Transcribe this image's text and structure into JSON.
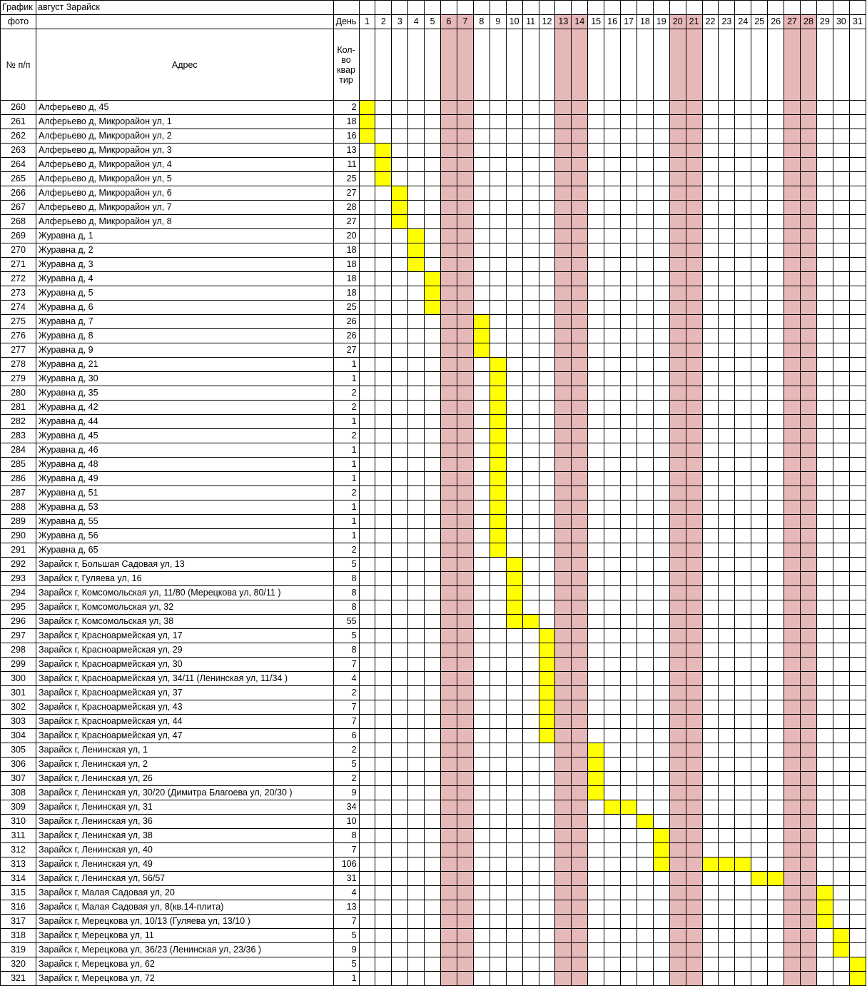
{
  "header": {
    "row1_col1": "График",
    "row1_col2": "август Зарайск",
    "row2_col1": "фото",
    "row2_col3": "День",
    "row3_col1": "№ п/п",
    "row3_col2": "Адрес",
    "row3_col3_lines": [
      "Кол-",
      "во",
      "квар",
      "тир"
    ]
  },
  "days": [
    "1",
    "2",
    "3",
    "4",
    "5",
    "6",
    "7",
    "8",
    "9",
    "10",
    "11",
    "12",
    "13",
    "14",
    "15",
    "16",
    "17",
    "18",
    "19",
    "20",
    "21",
    "22",
    "23",
    "24",
    "25",
    "26",
    "27",
    "28",
    "29",
    "30",
    "31"
  ],
  "weekend_days": [
    6,
    7,
    13,
    14,
    20,
    21,
    27,
    28
  ],
  "colors": {
    "weekend": "#e6b8b7",
    "scheduled": "#ffff00"
  },
  "rows": [
    {
      "n": "260",
      "addr": "Алферьево д, 45",
      "cnt": "2",
      "days": [
        1
      ]
    },
    {
      "n": "261",
      "addr": "Алферьево д, Микрорайон ул, 1",
      "cnt": "18",
      "days": [
        1
      ]
    },
    {
      "n": "262",
      "addr": "Алферьево д, Микрорайон ул, 2",
      "cnt": "16",
      "days": [
        1
      ]
    },
    {
      "n": "263",
      "addr": "Алферьево д, Микрорайон ул, 3",
      "cnt": "13",
      "days": [
        2
      ]
    },
    {
      "n": "264",
      "addr": "Алферьево д, Микрорайон ул, 4",
      "cnt": "11",
      "days": [
        2
      ]
    },
    {
      "n": "265",
      "addr": "Алферьево д, Микрорайон ул, 5",
      "cnt": "25",
      "days": [
        2
      ]
    },
    {
      "n": "266",
      "addr": "Алферьево д, Микрорайон ул, 6",
      "cnt": "27",
      "days": [
        3
      ]
    },
    {
      "n": "267",
      "addr": "Алферьево д, Микрорайон ул, 7",
      "cnt": "28",
      "days": [
        3
      ]
    },
    {
      "n": "268",
      "addr": "Алферьево д, Микрорайон ул, 8",
      "cnt": "27",
      "days": [
        3
      ]
    },
    {
      "n": "269",
      "addr": "Журавна д, 1",
      "cnt": "20",
      "days": [
        4
      ]
    },
    {
      "n": "270",
      "addr": "Журавна д, 2",
      "cnt": "18",
      "days": [
        4
      ]
    },
    {
      "n": "271",
      "addr": "Журавна д, 3",
      "cnt": "18",
      "days": [
        4
      ]
    },
    {
      "n": "272",
      "addr": "Журавна д, 4",
      "cnt": "18",
      "days": [
        5
      ]
    },
    {
      "n": "273",
      "addr": "Журавна д, 5",
      "cnt": "18",
      "days": [
        5
      ]
    },
    {
      "n": "274",
      "addr": "Журавна д, 6",
      "cnt": "25",
      "days": [
        5
      ]
    },
    {
      "n": "275",
      "addr": "Журавна д, 7",
      "cnt": "26",
      "days": [
        8
      ]
    },
    {
      "n": "276",
      "addr": "Журавна д, 8",
      "cnt": "26",
      "days": [
        8
      ]
    },
    {
      "n": "277",
      "addr": "Журавна д, 9",
      "cnt": "27",
      "days": [
        8
      ]
    },
    {
      "n": "278",
      "addr": "Журавна д, 21",
      "cnt": "1",
      "days": [
        9
      ]
    },
    {
      "n": "279",
      "addr": "Журавна д, 30",
      "cnt": "1",
      "days": [
        9
      ]
    },
    {
      "n": "280",
      "addr": "Журавна д, 35",
      "cnt": "2",
      "days": [
        9
      ]
    },
    {
      "n": "281",
      "addr": "Журавна д, 42",
      "cnt": "2",
      "days": [
        9
      ]
    },
    {
      "n": "282",
      "addr": "Журавна д, 44",
      "cnt": "1",
      "days": [
        9
      ]
    },
    {
      "n": "283",
      "addr": "Журавна д, 45",
      "cnt": "2",
      "days": [
        9
      ]
    },
    {
      "n": "284",
      "addr": "Журавна д, 46",
      "cnt": "1",
      "days": [
        9
      ]
    },
    {
      "n": "285",
      "addr": "Журавна д, 48",
      "cnt": "1",
      "days": [
        9
      ]
    },
    {
      "n": "286",
      "addr": "Журавна д, 49",
      "cnt": "1",
      "days": [
        9
      ]
    },
    {
      "n": "287",
      "addr": "Журавна д, 51",
      "cnt": "2",
      "days": [
        9
      ]
    },
    {
      "n": "288",
      "addr": "Журавна д, 53",
      "cnt": "1",
      "days": [
        9
      ]
    },
    {
      "n": "289",
      "addr": "Журавна д, 55",
      "cnt": "1",
      "days": [
        9
      ]
    },
    {
      "n": "290",
      "addr": "Журавна д, 56",
      "cnt": "1",
      "days": [
        9
      ]
    },
    {
      "n": "291",
      "addr": "Журавна д, 65",
      "cnt": "2",
      "days": [
        9
      ]
    },
    {
      "n": "292",
      "addr": "Зарайск г, Большая Садовая ул, 13",
      "cnt": "5",
      "days": [
        10
      ]
    },
    {
      "n": "293",
      "addr": "Зарайск г, Гуляева ул, 16",
      "cnt": "8",
      "days": [
        10
      ]
    },
    {
      "n": "294",
      "addr": "Зарайск г, Комсомольская ул, 11/80 (Мерецкова ул, 80/11  )",
      "cnt": "8",
      "days": [
        10
      ]
    },
    {
      "n": "295",
      "addr": "Зарайск г, Комсомольская ул, 32",
      "cnt": "8",
      "days": [
        10
      ]
    },
    {
      "n": "296",
      "addr": "Зарайск г, Комсомольская ул, 38",
      "cnt": "55",
      "days": [
        10,
        11
      ]
    },
    {
      "n": "297",
      "addr": "Зарайск г, Красноармейская ул, 17",
      "cnt": "5",
      "days": [
        12
      ]
    },
    {
      "n": "298",
      "addr": "Зарайск г, Красноармейская ул, 29",
      "cnt": "8",
      "days": [
        12
      ]
    },
    {
      "n": "299",
      "addr": "Зарайск г, Красноармейская ул, 30",
      "cnt": "7",
      "days": [
        12
      ]
    },
    {
      "n": "300",
      "addr": "Зарайск г, Красноармейская ул, 34/11 (Ленинская ул, 11/34  )",
      "cnt": "4",
      "days": [
        12
      ]
    },
    {
      "n": "301",
      "addr": "Зарайск г, Красноармейская ул, 37",
      "cnt": "2",
      "days": [
        12
      ]
    },
    {
      "n": "302",
      "addr": "Зарайск г, Красноармейская ул, 43",
      "cnt": "7",
      "days": [
        12
      ]
    },
    {
      "n": "303",
      "addr": "Зарайск г, Красноармейская ул, 44",
      "cnt": "7",
      "days": [
        12
      ]
    },
    {
      "n": "304",
      "addr": "Зарайск г, Красноармейская ул, 47",
      "cnt": "6",
      "days": [
        12
      ]
    },
    {
      "n": "305",
      "addr": "Зарайск г, Ленинская ул, 1",
      "cnt": "2",
      "days": [
        15
      ]
    },
    {
      "n": "306",
      "addr": "Зарайск г, Ленинская ул, 2",
      "cnt": "5",
      "days": [
        15
      ]
    },
    {
      "n": "307",
      "addr": "Зарайск г, Ленинская ул, 26",
      "cnt": "2",
      "days": [
        15
      ]
    },
    {
      "n": "308",
      "addr": "Зарайск г, Ленинская ул, 30/20 (Димитра Благоева ул, 20/30  )",
      "cnt": "9",
      "days": [
        15
      ]
    },
    {
      "n": "309",
      "addr": "Зарайск г, Ленинская ул, 31",
      "cnt": "34",
      "days": [
        16,
        17
      ]
    },
    {
      "n": "310",
      "addr": "Зарайск г, Ленинская ул, 36",
      "cnt": "10",
      "days": [
        18
      ]
    },
    {
      "n": "311",
      "addr": "Зарайск г, Ленинская ул, 38",
      "cnt": "8",
      "days": [
        19
      ]
    },
    {
      "n": "312",
      "addr": "Зарайск г, Ленинская ул, 40",
      "cnt": "7",
      "days": [
        19
      ]
    },
    {
      "n": "313",
      "addr": "Зарайск г, Ленинская ул, 49",
      "cnt": "106",
      "days": [
        19,
        22,
        23,
        24
      ]
    },
    {
      "n": "314",
      "addr": "Зарайск г, Ленинская ул, 56/57",
      "cnt": "31",
      "days": [
        25,
        26
      ]
    },
    {
      "n": "315",
      "addr": "Зарайск г, Малая Садовая ул, 20",
      "cnt": "4",
      "days": [
        29
      ]
    },
    {
      "n": "316",
      "addr": "Зарайск г, Малая Садовая ул, 8(кв.14-плита)",
      "cnt": "13",
      "days": [
        29
      ]
    },
    {
      "n": "317",
      "addr": "Зарайск г, Мерецкова ул, 10/13 (Гуляева ул, 13/10  )",
      "cnt": "7",
      "days": [
        29
      ]
    },
    {
      "n": "318",
      "addr": "Зарайск г, Мерецкова ул, 11",
      "cnt": "5",
      "days": [
        30
      ]
    },
    {
      "n": "319",
      "addr": "Зарайск г, Мерецкова ул, 36/23 (Ленинская ул, 23/36  )",
      "cnt": "9",
      "days": [
        30
      ]
    },
    {
      "n": "320",
      "addr": "Зарайск г, Мерецкова ул, 62",
      "cnt": "5",
      "days": [
        31
      ]
    },
    {
      "n": "321",
      "addr": "Зарайск г, Мерецкова ул, 72",
      "cnt": "1",
      "days": [
        31
      ]
    }
  ]
}
